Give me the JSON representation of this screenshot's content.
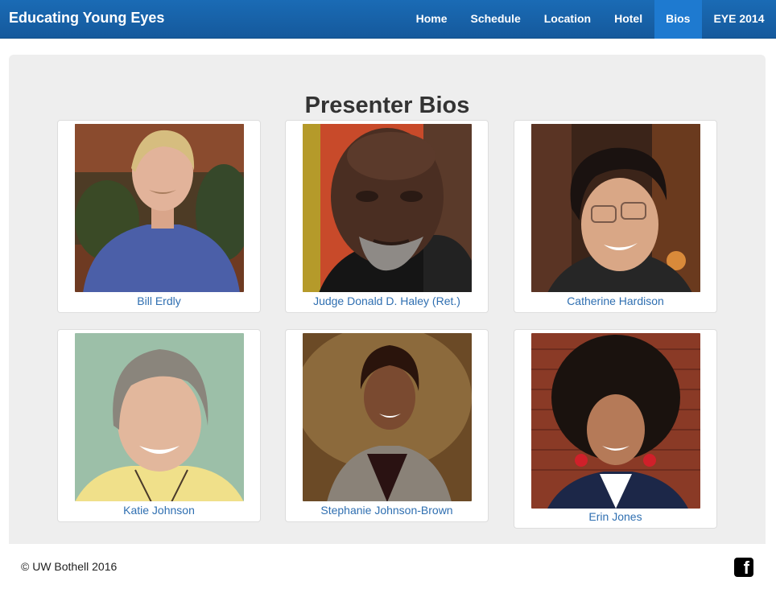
{
  "header": {
    "brand": "Educating Young Eyes",
    "nav": [
      {
        "label": "Home",
        "active": false
      },
      {
        "label": "Schedule",
        "active": false
      },
      {
        "label": "Location",
        "active": false
      },
      {
        "label": "Hotel",
        "active": false
      },
      {
        "label": "Bios",
        "active": true
      },
      {
        "label": "EYE 2014",
        "active": false
      }
    ]
  },
  "main": {
    "title": "Presenter Bios",
    "presenters": [
      {
        "name": "Bill Erdly"
      },
      {
        "name": "Judge Donald D. Haley (Ret.)"
      },
      {
        "name": "Catherine Hardison"
      },
      {
        "name": "Katie Johnson"
      },
      {
        "name": "Stephanie Johnson-Brown"
      },
      {
        "name": "Erin Jones"
      }
    ]
  },
  "footer": {
    "copyright": "© UW Bothell 2016",
    "social_icon": "facebook-icon"
  },
  "colors": {
    "navbar": "#15599c",
    "nav_active": "#1e7ad0",
    "link": "#2f6fb1",
    "panel": "#eeeeee"
  }
}
